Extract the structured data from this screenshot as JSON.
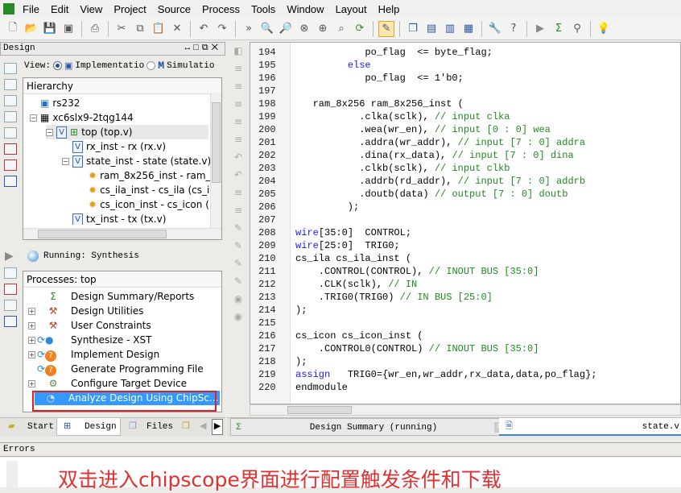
{
  "menu": [
    "File",
    "Edit",
    "View",
    "Project",
    "Source",
    "Process",
    "Tools",
    "Window",
    "Layout",
    "Help"
  ],
  "design_panel": {
    "title": "Design",
    "view_label": "View:",
    "impl_label": "Implementatio",
    "sim_label": "Simulatio",
    "hierarchy_header": "Hierarchy",
    "tree": [
      {
        "label": "rs232",
        "icon": "project-icon",
        "depth": 0
      },
      {
        "label": "xc6slx9-2tqg144",
        "icon": "chip-icon",
        "depth": 0,
        "expand": "−"
      },
      {
        "label": "top (top.v)",
        "icon": "verilog-top-icon",
        "depth": 1,
        "expand": "−",
        "selected": true
      },
      {
        "label": "rx_inst - rx (rx.v)",
        "icon": "verilog-file-icon",
        "depth": 2
      },
      {
        "label": "state_inst - state (state.v)",
        "icon": "verilog-file-icon",
        "depth": 2,
        "expand": "−"
      },
      {
        "label": "ram_8x256_inst - ram_",
        "icon": "core-bulb-icon",
        "depth": 3
      },
      {
        "label": "cs_ila_inst - cs_ila (cs_i",
        "icon": "core-bulb-icon",
        "depth": 3
      },
      {
        "label": "cs_icon_inst - cs_icon (",
        "icon": "core-bulb-icon",
        "depth": 3
      },
      {
        "label": "tx_inst - tx (tx.v)",
        "icon": "verilog-file-icon",
        "depth": 2
      }
    ]
  },
  "running": "Running: Synthesis",
  "processes": {
    "header": "Processes: top",
    "items": [
      {
        "label": "Design Summary/Reports",
        "icon": "sigma-icon",
        "expand": false
      },
      {
        "label": "Design Utilities",
        "icon": "tools-icon",
        "expand": true
      },
      {
        "label": "User Constraints",
        "icon": "tools-icon",
        "expand": true
      },
      {
        "label": "Synthesize - XST",
        "icon": "running-icon",
        "expand": true
      },
      {
        "label": "Implement Design",
        "icon": "question-icon",
        "expand": true
      },
      {
        "label": "Generate Programming File",
        "icon": "question-icon",
        "expand": false
      },
      {
        "label": "Configure Target Device",
        "icon": "configure-icon",
        "expand": true
      },
      {
        "label": "Analyze Design Using ChipSc...",
        "icon": "chipscope-icon",
        "expand": false,
        "selected": true
      }
    ]
  },
  "left_tabs": [
    "Start",
    "Design",
    "Files"
  ],
  "editor_tabs": [
    {
      "label": "Design Summary (running)"
    },
    {
      "label": "state.v"
    }
  ],
  "code": [
    {
      "n": "194",
      "s": [
        [
          "            po_flag  <= byte_flag;",
          ""
        ]
      ]
    },
    {
      "n": "195",
      "s": [
        [
          "         ",
          ""
        ],
        [
          "else",
          "kw"
        ]
      ]
    },
    {
      "n": "196",
      "s": [
        [
          "            po_flag  <= 1'b0;",
          ""
        ]
      ]
    },
    {
      "n": "197",
      "s": [
        [
          "",
          ""
        ]
      ]
    },
    {
      "n": "198",
      "s": [
        [
          "   ram_8x256 ram_8x256_inst (",
          ""
        ]
      ]
    },
    {
      "n": "199",
      "s": [
        [
          "           .clka(sclk), ",
          ""
        ],
        [
          "// input clka",
          "cm"
        ]
      ]
    },
    {
      "n": "200",
      "s": [
        [
          "           .wea(wr_en), ",
          ""
        ],
        [
          "// input [0 : 0] wea",
          "cm"
        ]
      ]
    },
    {
      "n": "201",
      "s": [
        [
          "           .addra(wr_addr), ",
          ""
        ],
        [
          "// input [7 : 0] addra",
          "cm"
        ]
      ]
    },
    {
      "n": "202",
      "s": [
        [
          "           .dina(rx_data), ",
          ""
        ],
        [
          "// input [7 : 0] dina",
          "cm"
        ]
      ]
    },
    {
      "n": "203",
      "s": [
        [
          "           .clkb(sclk), ",
          ""
        ],
        [
          "// input clkb",
          "cm"
        ]
      ]
    },
    {
      "n": "204",
      "s": [
        [
          "           .addrb(rd_addr), ",
          ""
        ],
        [
          "// input [7 : 0] addrb",
          "cm"
        ]
      ]
    },
    {
      "n": "205",
      "s": [
        [
          "           .doutb(data) ",
          ""
        ],
        [
          "// output [7 : 0] doutb",
          "cm"
        ]
      ]
    },
    {
      "n": "206",
      "s": [
        [
          "         );",
          ""
        ]
      ]
    },
    {
      "n": "207",
      "s": [
        [
          "",
          ""
        ]
      ]
    },
    {
      "n": "208",
      "s": [
        [
          "wire",
          "kw"
        ],
        [
          "[35:0]  CONTROL;",
          ""
        ]
      ]
    },
    {
      "n": "209",
      "s": [
        [
          "wire",
          "kw"
        ],
        [
          "[25:0]  TRIG0;",
          ""
        ]
      ]
    },
    {
      "n": "210",
      "s": [
        [
          "cs_ila cs_ila_inst (",
          ""
        ]
      ]
    },
    {
      "n": "211",
      "s": [
        [
          "    .CONTROL(CONTROL), ",
          ""
        ],
        [
          "// INOUT BUS [35:0]",
          "cm"
        ]
      ]
    },
    {
      "n": "212",
      "s": [
        [
          "    .CLK(sclk), ",
          ""
        ],
        [
          "// IN",
          "cm"
        ]
      ]
    },
    {
      "n": "213",
      "s": [
        [
          "    .TRIG0(TRIG0) ",
          ""
        ],
        [
          "// IN BUS [25:0]",
          "cm"
        ]
      ]
    },
    {
      "n": "214",
      "s": [
        [
          ");",
          ""
        ]
      ]
    },
    {
      "n": "215",
      "s": [
        [
          "",
          ""
        ]
      ]
    },
    {
      "n": "216",
      "s": [
        [
          "cs_icon cs_icon_inst (",
          ""
        ]
      ]
    },
    {
      "n": "217",
      "s": [
        [
          "    .CONTROL0(CONTROL) ",
          ""
        ],
        [
          "// INOUT BUS [35:0]",
          "cm"
        ]
      ]
    },
    {
      "n": "218",
      "s": [
        [
          ");",
          ""
        ]
      ]
    },
    {
      "n": "219",
      "s": [
        [
          "assign",
          "kw"
        ],
        [
          "   TRIG0={wr_en,wr_addr,rx_data,data,po_flag};",
          ""
        ]
      ]
    },
    {
      "n": "220",
      "s": [
        [
          "endmodule",
          ""
        ]
      ]
    }
  ],
  "errors_label": "Errors",
  "annotation": "双击进入chipscope界面进行配置触发条件和下载",
  "colors": {
    "keyword": "#1a1aff",
    "comment": "#208a20",
    "selection": "#3399ff",
    "highlight_box": "#e02020",
    "annotation": "#e03030"
  }
}
